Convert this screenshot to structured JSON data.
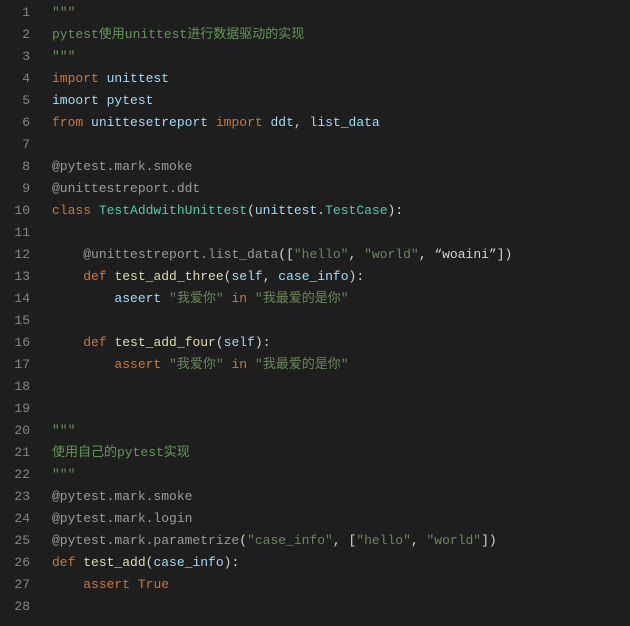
{
  "lines": [
    {
      "num": 1,
      "tokens": [
        {
          "t": "\"\"\"",
          "c": "tok-docstr"
        }
      ]
    },
    {
      "num": 2,
      "tokens": [
        {
          "t": "pytest使用unittest进行数据驱动的实现",
          "c": "tok-docstr"
        }
      ]
    },
    {
      "num": 3,
      "tokens": [
        {
          "t": "\"\"\"",
          "c": "tok-docstr"
        }
      ]
    },
    {
      "num": 4,
      "tokens": [
        {
          "t": "import",
          "c": "tok-kw"
        },
        {
          "t": " ",
          "c": ""
        },
        {
          "t": "unittest",
          "c": "tok-id"
        }
      ]
    },
    {
      "num": 5,
      "tokens": [
        {
          "t": "imoort",
          "c": "tok-id"
        },
        {
          "t": " ",
          "c": ""
        },
        {
          "t": "pytest",
          "c": "tok-id"
        }
      ]
    },
    {
      "num": 6,
      "tokens": [
        {
          "t": "from",
          "c": "tok-kw"
        },
        {
          "t": " ",
          "c": ""
        },
        {
          "t": "unittesetreport",
          "c": "tok-id"
        },
        {
          "t": " ",
          "c": ""
        },
        {
          "t": "import",
          "c": "tok-kw"
        },
        {
          "t": " ",
          "c": ""
        },
        {
          "t": "ddt",
          "c": "tok-id"
        },
        {
          "t": ", ",
          "c": "tok-punc"
        },
        {
          "t": "list_data",
          "c": "tok-id"
        }
      ]
    },
    {
      "num": 7,
      "tokens": []
    },
    {
      "num": 8,
      "tokens": [
        {
          "t": "@pytest.mark.smoke",
          "c": "tok-dec"
        }
      ]
    },
    {
      "num": 9,
      "tokens": [
        {
          "t": "@unittestreport.ddt",
          "c": "tok-dec"
        }
      ]
    },
    {
      "num": 10,
      "tokens": [
        {
          "t": "class",
          "c": "tok-kw"
        },
        {
          "t": " ",
          "c": ""
        },
        {
          "t": "TestAddwithUnittest",
          "c": "tok-cls"
        },
        {
          "t": "(",
          "c": "tok-punc"
        },
        {
          "t": "unittest",
          "c": "tok-id"
        },
        {
          "t": ".",
          "c": "tok-punc"
        },
        {
          "t": "TestCase",
          "c": "tok-cls"
        },
        {
          "t": "):",
          "c": "tok-punc"
        }
      ]
    },
    {
      "num": 11,
      "tokens": []
    },
    {
      "num": 12,
      "tokens": [
        {
          "t": "    ",
          "c": ""
        },
        {
          "t": "@unittestreport.list_data",
          "c": "tok-dec"
        },
        {
          "t": "([",
          "c": "tok-punc"
        },
        {
          "t": "\"hello\"",
          "c": "tok-str"
        },
        {
          "t": ", ",
          "c": "tok-punc"
        },
        {
          "t": "\"world\"",
          "c": "tok-str"
        },
        {
          "t": ", ",
          "c": "tok-punc"
        },
        {
          "t": "“woaini”",
          "c": "tok-punc"
        },
        {
          "t": "])",
          "c": "tok-punc"
        }
      ]
    },
    {
      "num": 13,
      "tokens": [
        {
          "t": "    ",
          "c": ""
        },
        {
          "t": "def",
          "c": "tok-kw"
        },
        {
          "t": " ",
          "c": ""
        },
        {
          "t": "test_add_three",
          "c": "tok-func"
        },
        {
          "t": "(",
          "c": "tok-punc"
        },
        {
          "t": "self",
          "c": "tok-param"
        },
        {
          "t": ", ",
          "c": "tok-punc"
        },
        {
          "t": "case_info",
          "c": "tok-param"
        },
        {
          "t": "):",
          "c": "tok-punc"
        }
      ]
    },
    {
      "num": 14,
      "tokens": [
        {
          "t": "        ",
          "c": ""
        },
        {
          "t": "aseert",
          "c": "tok-id"
        },
        {
          "t": " ",
          "c": ""
        },
        {
          "t": "\"我爱你\"",
          "c": "tok-str"
        },
        {
          "t": " ",
          "c": ""
        },
        {
          "t": "in",
          "c": "tok-kw"
        },
        {
          "t": " ",
          "c": ""
        },
        {
          "t": "\"我最爱的是你\"",
          "c": "tok-str"
        }
      ]
    },
    {
      "num": 15,
      "tokens": []
    },
    {
      "num": 16,
      "tokens": [
        {
          "t": "    ",
          "c": ""
        },
        {
          "t": "def",
          "c": "tok-kw"
        },
        {
          "t": " ",
          "c": ""
        },
        {
          "t": "test_add_four",
          "c": "tok-func"
        },
        {
          "t": "(",
          "c": "tok-punc"
        },
        {
          "t": "self",
          "c": "tok-param"
        },
        {
          "t": "):",
          "c": "tok-punc"
        }
      ]
    },
    {
      "num": 17,
      "tokens": [
        {
          "t": "        ",
          "c": ""
        },
        {
          "t": "assert",
          "c": "tok-kw"
        },
        {
          "t": " ",
          "c": ""
        },
        {
          "t": "\"我爱你\"",
          "c": "tok-str"
        },
        {
          "t": " ",
          "c": ""
        },
        {
          "t": "in",
          "c": "tok-kw"
        },
        {
          "t": " ",
          "c": ""
        },
        {
          "t": "\"我最爱的是你\"",
          "c": "tok-str"
        }
      ]
    },
    {
      "num": 18,
      "tokens": []
    },
    {
      "num": 19,
      "tokens": []
    },
    {
      "num": 20,
      "tokens": [
        {
          "t": "\"\"\"",
          "c": "tok-docstr"
        }
      ]
    },
    {
      "num": 21,
      "tokens": [
        {
          "t": "使用自己的pytest实现",
          "c": "tok-docstr"
        }
      ]
    },
    {
      "num": 22,
      "tokens": [
        {
          "t": "\"\"\"",
          "c": "tok-docstr"
        }
      ]
    },
    {
      "num": 23,
      "tokens": [
        {
          "t": "@pytest.mark.smoke",
          "c": "tok-dec"
        }
      ]
    },
    {
      "num": 24,
      "tokens": [
        {
          "t": "@pytest.mark.login",
          "c": "tok-dec"
        }
      ]
    },
    {
      "num": 25,
      "tokens": [
        {
          "t": "@pytest.mark.parametrize",
          "c": "tok-dec"
        },
        {
          "t": "(",
          "c": "tok-punc"
        },
        {
          "t": "\"case_info\"",
          "c": "tok-str"
        },
        {
          "t": ", [",
          "c": "tok-punc"
        },
        {
          "t": "\"hello\"",
          "c": "tok-str"
        },
        {
          "t": ", ",
          "c": "tok-punc"
        },
        {
          "t": "\"world\"",
          "c": "tok-str"
        },
        {
          "t": "])",
          "c": "tok-punc"
        }
      ]
    },
    {
      "num": 26,
      "tokens": [
        {
          "t": "def",
          "c": "tok-kw"
        },
        {
          "t": " ",
          "c": ""
        },
        {
          "t": "test_add",
          "c": "tok-func"
        },
        {
          "t": "(",
          "c": "tok-punc"
        },
        {
          "t": "case_info",
          "c": "tok-param"
        },
        {
          "t": "):",
          "c": "tok-punc"
        }
      ]
    },
    {
      "num": 27,
      "tokens": [
        {
          "t": "    ",
          "c": ""
        },
        {
          "t": "assert",
          "c": "tok-kw"
        },
        {
          "t": " ",
          "c": ""
        },
        {
          "t": "True",
          "c": "tok-const"
        }
      ]
    },
    {
      "num": 28,
      "tokens": []
    }
  ]
}
